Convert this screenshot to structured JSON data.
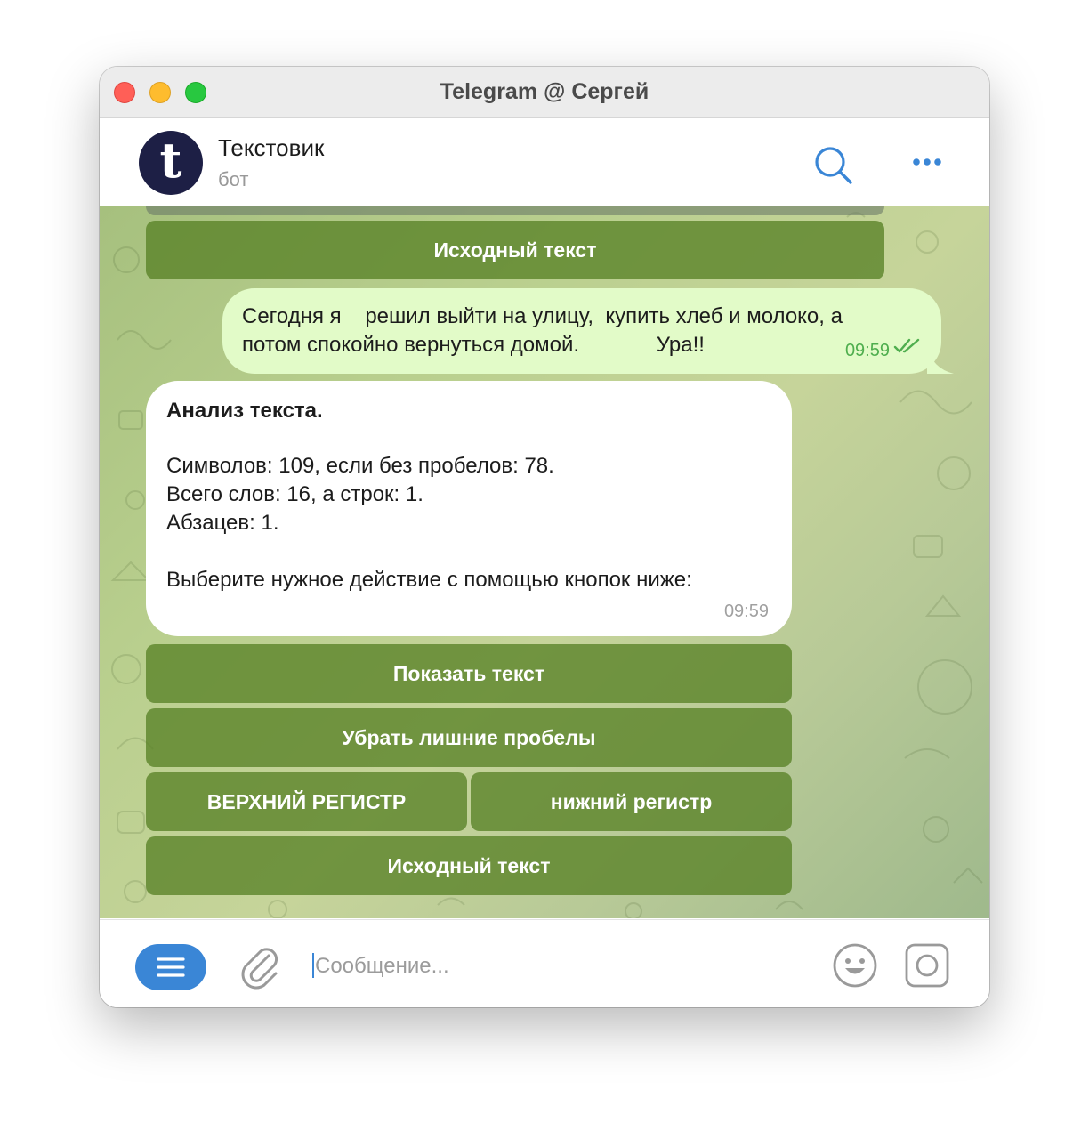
{
  "window": {
    "title": "Telegram @ Сергей",
    "controls": [
      "close",
      "minimize",
      "zoom"
    ]
  },
  "header": {
    "avatar_letter": "t",
    "avatar_color": "#1d1f45",
    "name": "Текстовик",
    "status": "бот",
    "icons": [
      "search-icon",
      "more-icon"
    ]
  },
  "top_keyboard": {
    "buttons": [
      {
        "label": "Исходный текст"
      }
    ]
  },
  "outgoing_message": {
    "line1": "Сегодня я    решил выйти на улицу,  купить хлеб и молоко, а",
    "line2": "потом спокойно вернуться домой.             Ура!!",
    "time": "09:59",
    "status_icon": "double-check-icon"
  },
  "incoming_message": {
    "title": "Анализ текста.",
    "lines": [
      "Символов: 109, если без пробелов: 78.",
      "Всего слов: 16, а строк: 1.",
      "Абзацев: 1.",
      "Выберите нужное действие с помощью кнопок ниже:"
    ],
    "time": "09:59"
  },
  "inline_keyboard": {
    "rows": [
      [
        "Показать текст"
      ],
      [
        "Убрать лишние пробелы"
      ],
      [
        "ВЕРХНИЙ РЕГИСТР",
        "нижний регистр"
      ],
      [
        "Исходный текст"
      ]
    ]
  },
  "composer": {
    "placeholder": "Сообщение...",
    "value": "",
    "icons": [
      "menu-icon",
      "paperclip-icon",
      "emoji-icon",
      "camera-icon"
    ]
  },
  "colors": {
    "accent": "#3a86d6",
    "outgoing_bubble": "#e2fbc8",
    "incoming_bubble": "#ffffff",
    "keyboard_button": "#58822699",
    "read_check": "#4fae4e"
  }
}
